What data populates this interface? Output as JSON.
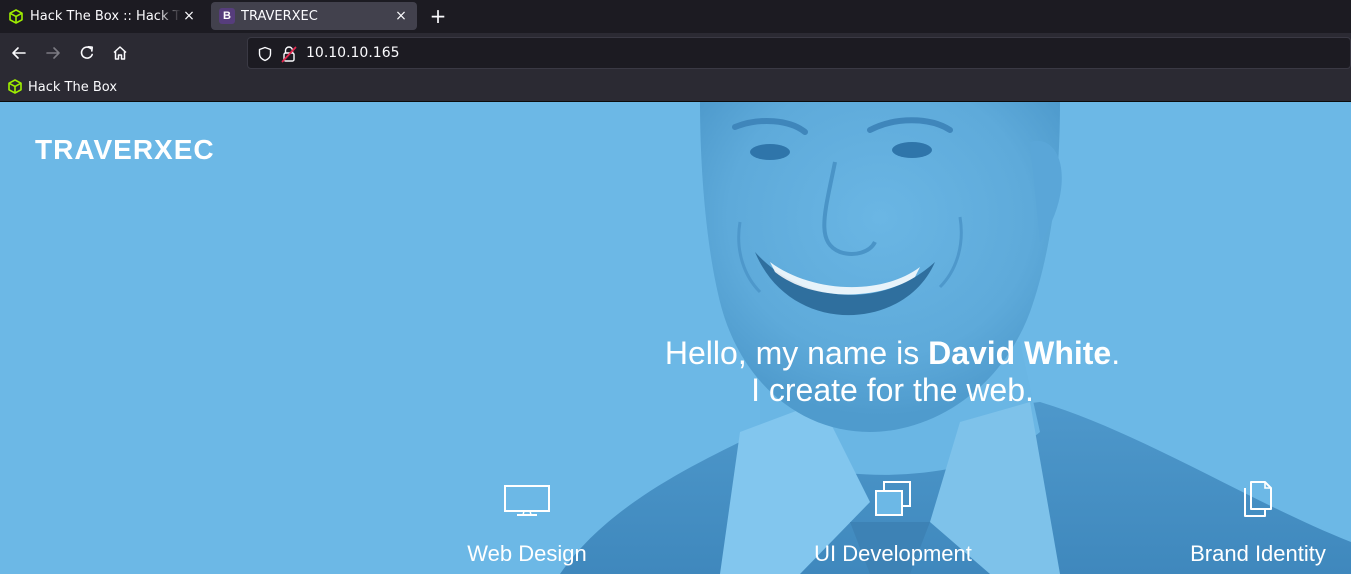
{
  "browser": {
    "tabs": [
      {
        "title": "Hack The Box :: Hack The Box",
        "active": false,
        "favicon": "htb-cube-icon"
      },
      {
        "title": "TRAVERXEC",
        "active": true,
        "favicon": "bootstrap-b-icon",
        "favicon_letter": "B"
      }
    ],
    "new_tab_label": "+",
    "close_glyph": "×",
    "url": "10.10.10.165",
    "bookmarks": [
      {
        "label": "Hack The Box",
        "icon": "htb-cube-icon"
      }
    ],
    "colors": {
      "tabbar": "#1c1b22",
      "toolbar": "#2b2a33",
      "active_tab": "#42414d",
      "htb_green": "#9fef00"
    }
  },
  "page": {
    "brand": "TRAVERXEC",
    "intro": {
      "prefix": "Hello, my name is ",
      "name": "David White",
      "suffix": ".",
      "line2": "I create for the web."
    },
    "services": [
      {
        "label": "Web Design",
        "icon": "monitor-icon"
      },
      {
        "label": "UI Development",
        "icon": "stacked-squares-icon"
      },
      {
        "label": "Brand Identity",
        "icon": "documents-icon"
      }
    ],
    "colors": {
      "hero_overlay": "#6cb8e6",
      "text": "#ffffff"
    }
  }
}
